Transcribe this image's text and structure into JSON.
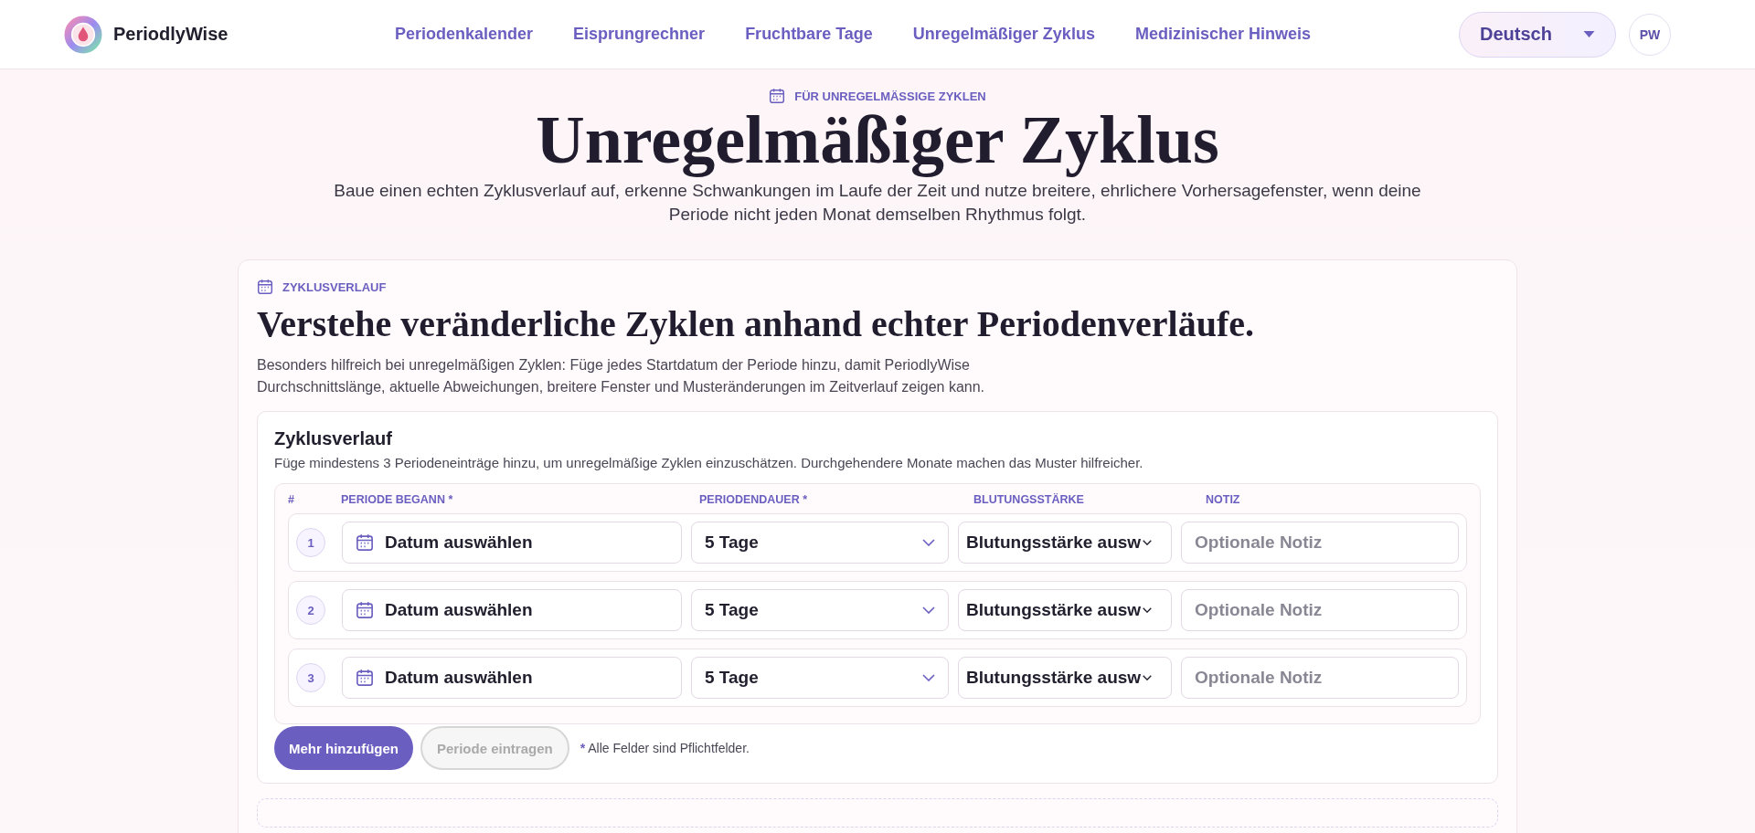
{
  "header": {
    "brand": "PeriodlyWise",
    "nav": [
      "Periodenkalender",
      "Eisprungrechner",
      "Fruchtbare Tage",
      "Unregelmäßiger Zyklus",
      "Medizinischer Hinweis"
    ],
    "language": "Deutsch",
    "avatar": "PW"
  },
  "hero": {
    "eyebrow": "FÜR UNREGELMÄSSIGE ZYKLEN",
    "title": "Unregelmäßiger Zyklus",
    "subtitle": "Baue einen echten Zyklusverlauf auf, erkenne Schwankungen im Laufe der Zeit und nutze breitere, ehrlichere Vorhersagefenster, wenn deine Periode nicht jeden Monat demselben Rhythmus folgt."
  },
  "card": {
    "eyebrow": "ZYKLUSVERLAUF",
    "title": "Verstehe veränderliche Zyklen anhand echter Periodenverläufe.",
    "text": "Besonders hilfreich bei unregelmäßigen Zyklen: Füge jedes Startdatum der Periode hinzu, damit PeriodlyWise Durchschnittslänge, aktuelle Abweichungen, breitere Fenster und Musteränderungen im Zeitverlauf zeigen kann.",
    "history": {
      "title": "Zyklusverlauf",
      "hint": "Füge mindestens 3 Periodeneinträge hinzu, um unregelmäßige Zyklen einzuschätzen. Durchgehendere Monate machen das Muster hilfreicher.",
      "columns": [
        "#",
        "PERIODE BEGANN *",
        "PERIODENDAUER *",
        "BLUTUNGSSTÄRKE",
        "NOTIZ"
      ],
      "rows": [
        {
          "number": "1",
          "date": "Datum auswählen",
          "duration": "5 Tage",
          "flow": "Blutungsstärke ausw",
          "note_placeholder": "Optionale Notiz"
        },
        {
          "number": "2",
          "date": "Datum auswählen",
          "duration": "5 Tage",
          "flow": "Blutungsstärke ausw",
          "note_placeholder": "Optionale Notiz"
        },
        {
          "number": "3",
          "date": "Datum auswählen",
          "duration": "5 Tage",
          "flow": "Blutungsstärke ausw",
          "note_placeholder": "Optionale Notiz"
        }
      ],
      "buttons": [
        {
          "label": "Mehr hinzufügen",
          "disabled": false
        },
        {
          "label": "Periode eintragen",
          "disabled": true
        }
      ],
      "required_mark": "*",
      "required_note": "Alle Felder sind Pflichtfelder."
    }
  }
}
